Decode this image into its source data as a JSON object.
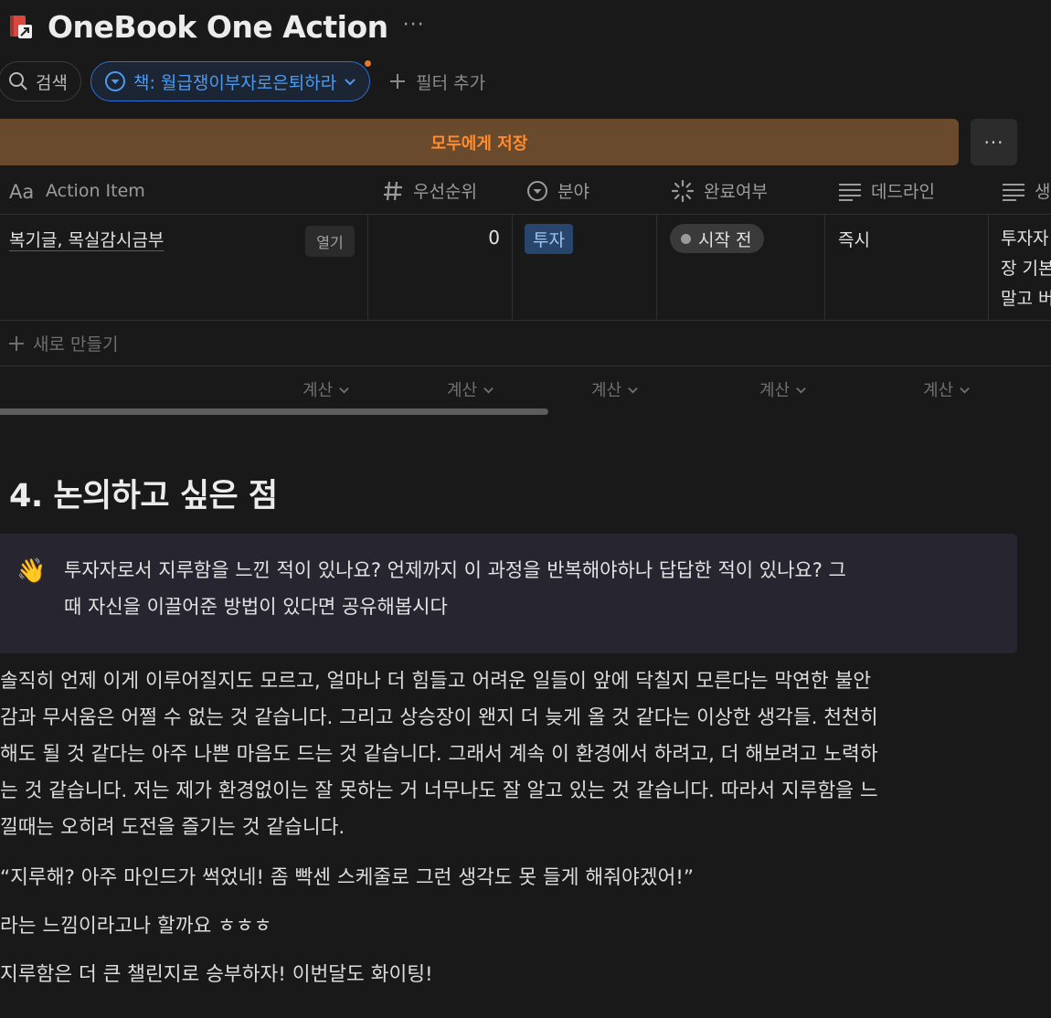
{
  "page": {
    "title": "OneBook One Action",
    "more_label": "···"
  },
  "filters": {
    "search_label": "검색",
    "active_filter_label": "책: 월급쟁이부자로은퇴하라",
    "add_filter_label": "필터 추가"
  },
  "save_bar": {
    "label": "모두에게 저장",
    "more_label": "···"
  },
  "table": {
    "columns": [
      {
        "label": "Action Item",
        "icon": "title-aa-icon"
      },
      {
        "label": "우선순위",
        "icon": "number-hash-icon"
      },
      {
        "label": "분야",
        "icon": "select-chevron-icon"
      },
      {
        "label": "완료여부",
        "icon": "status-spinner-icon"
      },
      {
        "label": "데드라인",
        "icon": "text-lines-icon"
      },
      {
        "label": "생",
        "icon": "text-lines-icon"
      }
    ],
    "rows": [
      {
        "name": "복기글, 목실감시금부",
        "open_label": "열기",
        "priority": "0",
        "field": "투자",
        "status": "시작 전",
        "deadline": "즉시",
        "extra_lines": [
          "투자자",
          "장 기본",
          "말고 버"
        ]
      }
    ],
    "new_row_label": "새로 만들기",
    "calc_label": "계산"
  },
  "section": {
    "heading": "4. 논의하고 싶은 점",
    "callout_emoji": "👋",
    "callout_lines": [
      "투자자로서 지루함을 느낀 적이 있나요? 언제까지 이 과정을 반복해야하나 답답한 적이 있나요? 그",
      "때 자신을 이끌어준 방법이 있다면 공유해봅시다"
    ],
    "paragraph_lines": [
      "솔직히 언제 이게 이루어질지도 모르고, 얼마나 더 힘들고 어려운 일들이 앞에 닥칠지 모른다는 막연한 불안",
      "감과 무서움은 어쩔 수 없는 것 같습니다. 그리고 상승장이 왠지 더 늦게 올 것 같다는 이상한 생각들. 천천히",
      "해도 될 것 같다는 아주 나쁜 마음도 드는 것 같습니다. 그래서 계속 이 환경에서 하려고, 더 해보려고 노력하",
      "는 것 같습니다. 저는 제가 환경없이는 잘 못하는 거 너무나도 잘 알고 있는 것 같습니다. 따라서 지루함을 느",
      "낄때는 오히려 도전을 즐기는 것 같습니다."
    ],
    "quote": "“지루해? 아주 마인드가 썩었네! 좀 빡센 스케줄로 그런 생각도 못 들게 해줘야겠어!”",
    "line2": "라는 느낌이라고나 할까요 ㅎㅎㅎ",
    "line3": "지루함은 더 큰 챌린지로 승부하자! 이번달도 화이팅!"
  },
  "colors": {
    "background": "#191919",
    "accent_blue": "#2e6fd6",
    "save_bar_bg": "#6a4a2c",
    "save_bar_text": "#ff8c2e",
    "tag_bg": "#28456c",
    "callout_bg": "#27252f"
  }
}
